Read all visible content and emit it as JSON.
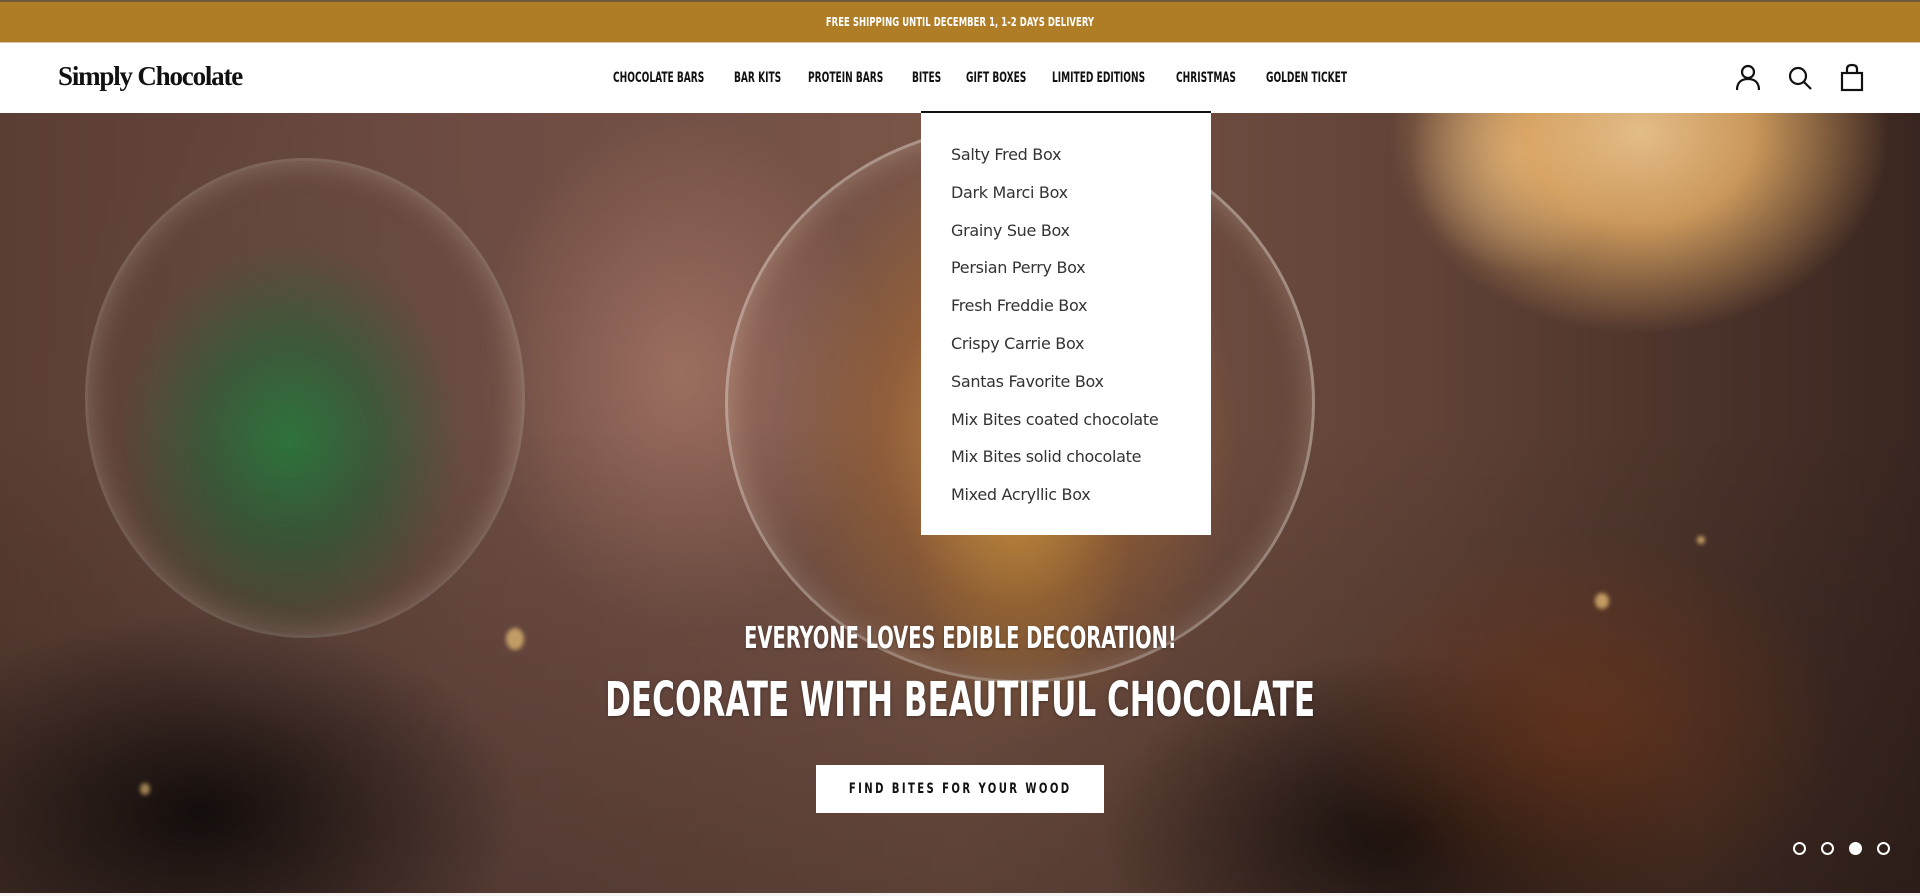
{
  "announcement": {
    "text": "FREE SHIPPING UNTIL DECEMBER 1, 1-2 DAYS DELIVERY",
    "background": "#b07d27"
  },
  "header": {
    "logo": "Simply Chocolate",
    "nav": [
      {
        "label": "CHOCOLATE BARS"
      },
      {
        "label": "BAR KITS"
      },
      {
        "label": "PROTEIN BARS"
      },
      {
        "label": "BITES",
        "active": true
      },
      {
        "label": "GIFT BOXES"
      },
      {
        "label": "LIMITED EDITIONS"
      },
      {
        "label": "CHRISTMAS"
      },
      {
        "label": "GOLDEN TICKET"
      }
    ],
    "icons": [
      "account-icon",
      "search-icon",
      "cart-bag-icon"
    ]
  },
  "dropdown": {
    "parent": "BITES",
    "items": [
      "Salty Fred Box",
      "Dark Marci Box",
      "Grainy Sue Box",
      "Persian Perry Box",
      "Fresh Freddie Box",
      "Crispy Carrie Box",
      "Santas Favorite Box",
      "Mix Bites coated chocolate",
      "Mix Bites solid chocolate",
      "Mixed Acryllic Box"
    ]
  },
  "hero": {
    "subtitle": "EVERYONE LOVES EDIBLE DECORATION!",
    "title": "DECORATE WITH BEAUTIFUL CHOCOLATE",
    "cta_label": "FIND BITES FOR YOUR WOOD",
    "slides_total": 4,
    "active_slide": 3
  }
}
